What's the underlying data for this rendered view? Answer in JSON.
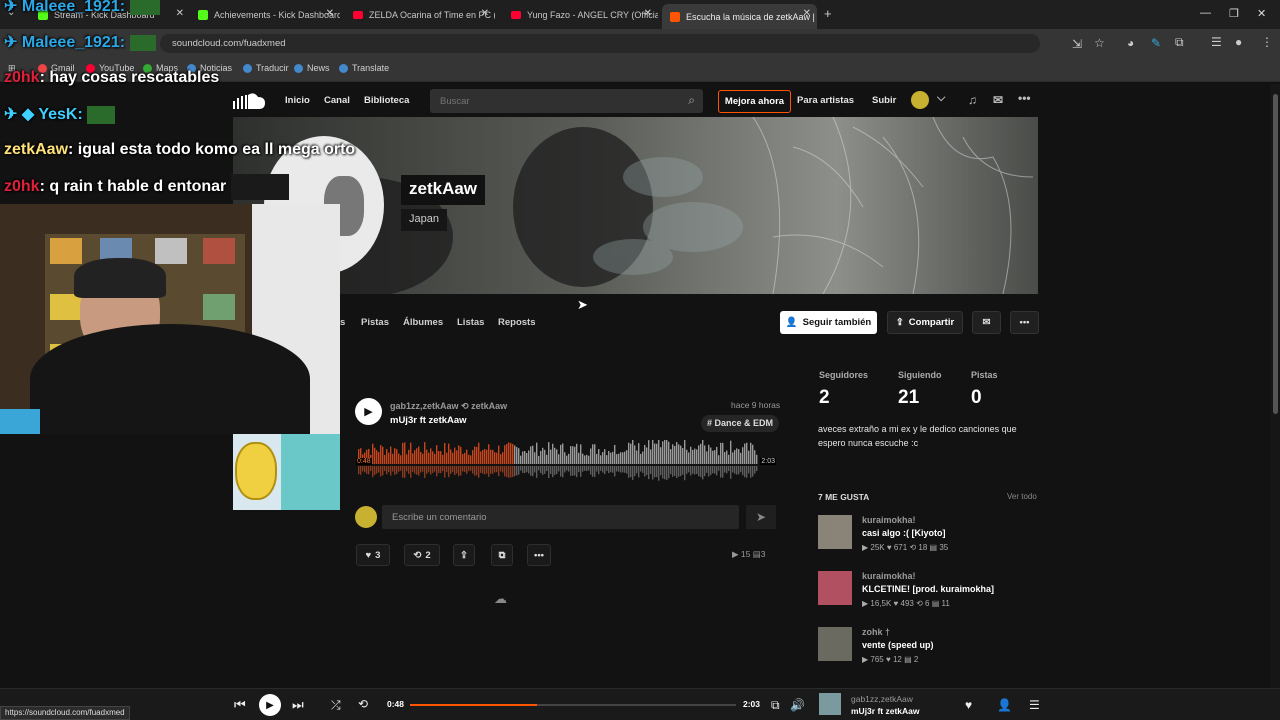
{
  "browser": {
    "tabs": [
      {
        "label": "Stream - Kick Dashboard"
      },
      {
        "label": "Achievements - Kick Dashboard"
      },
      {
        "label": "ZELDA Ocarina of Time en PC (..."
      },
      {
        "label": "Yung Fazo - ANGEL CRY (Officia..."
      },
      {
        "label": "Escucha la música de zetkAaw |"
      }
    ],
    "address": "soundcloud.com/fuadxmed",
    "bookmarks": [
      "Gmail",
      "YouTube",
      "Maps",
      "Noticias",
      "Traducir",
      "News",
      "Translate"
    ],
    "new_tab": "+"
  },
  "stream_overlay": {
    "chat": [
      {
        "user": "Maleee_1921:",
        "text": "",
        "color": "#2aa8e8"
      },
      {
        "user": "z0hk",
        "text": ": hay cosas rescatables",
        "color": "#e0203a"
      },
      {
        "user": "YesK:",
        "text": "",
        "color": "#3fd0ff"
      },
      {
        "user": "zetkAaw",
        "text": ": igual esta todo komo ea ll mega orto",
        "color": "#ffe27a"
      },
      {
        "user": "z0hk",
        "text": ": q rain t hable d entonar",
        "color": "#e0203a"
      }
    ]
  },
  "soundcloud": {
    "nav": {
      "home": "Inicio",
      "feed": "Canal",
      "library": "Biblioteca",
      "search_placeholder": "Buscar",
      "upgrade": "Mejora ahora",
      "artists": "Para artistas",
      "upload": "Subir"
    },
    "profile": {
      "name": "zetkAaw",
      "country": "Japan"
    },
    "tabs": [
      "s",
      "Pistas",
      "Álbumes",
      "Listas",
      "Reposts"
    ],
    "actions": {
      "follow": "Seguir también",
      "share": "Compartir"
    },
    "stats": [
      {
        "label": "Seguidores",
        "value": "2"
      },
      {
        "label": "Siguiendo",
        "value": "21"
      },
      {
        "label": "Pistas",
        "value": "0"
      }
    ],
    "bio": "aveces extraño a mi ex y le dedico canciones que espero nunca escuche :c",
    "likes_header": "7 ME GUSTA",
    "see_all": "Ver todo",
    "likes": [
      {
        "artist": "kuraimokha!",
        "title": "casi algo :( [Kiyoto]",
        "plays": "25K",
        "likes": "671",
        "reposts": "18",
        "comments": "35"
      },
      {
        "artist": "kuraimokha!",
        "title": "KLCETINE! [prod. kuraimokha]",
        "plays": "16,5K",
        "likes": "493",
        "reposts": "6",
        "comments": "11"
      },
      {
        "artist": "zohk †",
        "title": "vente (speed up)",
        "plays": "765",
        "likes": "12",
        "reposts": "",
        "comments": "2"
      }
    ],
    "track": {
      "user": "gab1zz,zetkAaw",
      "repost_by": "zetkAaw",
      "title": "mUj3r ft zetkAaw",
      "time_ago": "hace 9 horas",
      "tag": "# Dance & EDM",
      "position": "0:48",
      "duration": "2:03",
      "progress": 0.39,
      "comment_placeholder": "Escribe un comentario",
      "likes": "3",
      "reposts": "2",
      "plays": "15",
      "comments": "3"
    },
    "player": {
      "position": "0:48",
      "duration": "2:03",
      "progress": 0.39,
      "artist": "gab1zz,zetkAaw",
      "title": "mUj3r ft zetkAaw"
    }
  },
  "status_url": "https://soundcloud.com/fuadxmed",
  "colors": {
    "accent": "#ff5500",
    "bg": "#121212",
    "wave_played": "#c7441c",
    "wave_unplayed": "#9a9a9a"
  }
}
